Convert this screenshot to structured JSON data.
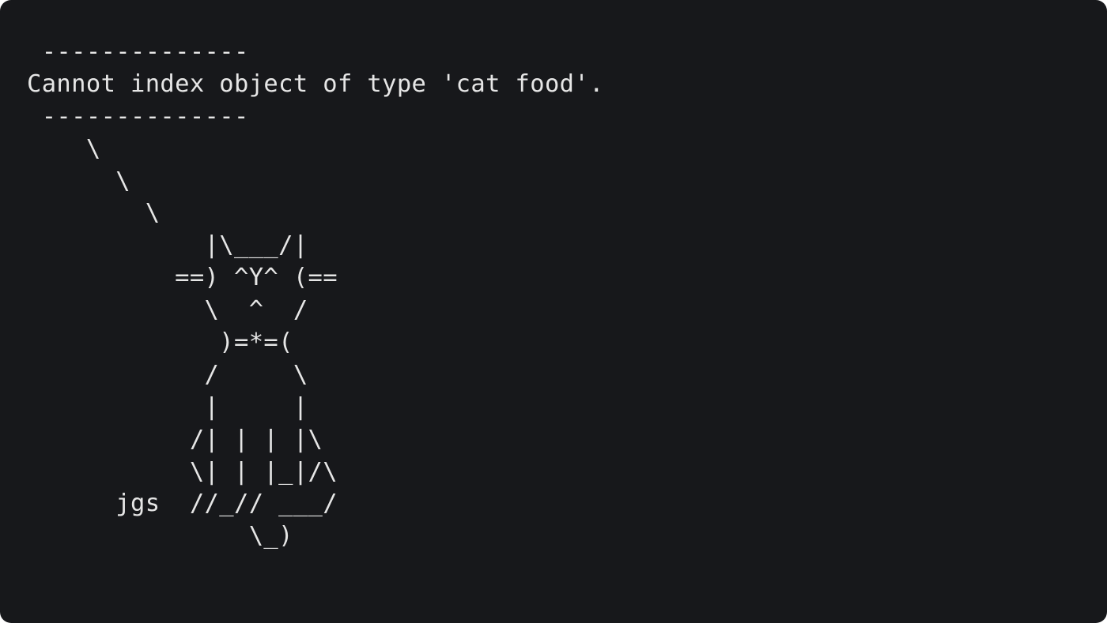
{
  "terminal": {
    "background": "#17181b",
    "foreground": "#e6e6e6",
    "lines": [
      " --------------",
      "Cannot index object of type 'cat food'.",
      " --------------",
      "    \\",
      "      \\",
      "        \\",
      "            |\\___/|",
      "          ==) ^Y^ (==",
      "            \\  ^  /",
      "             )=*=(",
      "            /     \\",
      "            |     |",
      "           /| | | |\\",
      "           \\| | |_|/\\",
      "      jgs  //_// ___/",
      "               \\_)"
    ]
  }
}
